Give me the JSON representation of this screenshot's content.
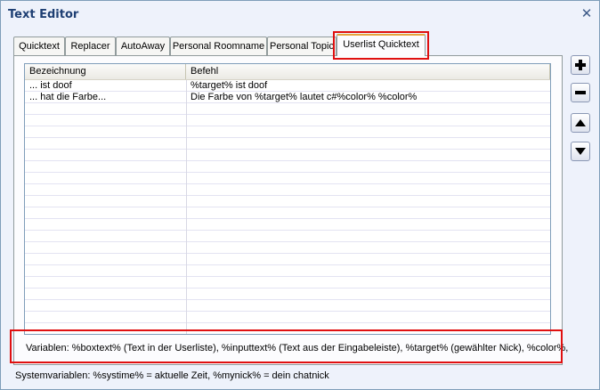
{
  "window": {
    "title": "Text Editor",
    "close_glyph": "✕"
  },
  "tabs": [
    {
      "label": "Quicktext",
      "active": false
    },
    {
      "label": "Replacer",
      "active": false
    },
    {
      "label": "AutoAway",
      "active": false
    },
    {
      "label": "Personal Roomname",
      "active": false
    },
    {
      "label": "Personal Topic",
      "active": false
    },
    {
      "label": "Userlist Quicktext",
      "active": true
    }
  ],
  "table": {
    "columns": [
      "Bezeichnung",
      "Befehl"
    ],
    "rows": [
      [
        "... ist doof",
        "%target% ist doof"
      ],
      [
        "... hat die Farbe...",
        "Die Farbe von %target% lautet c#%color% %color%"
      ]
    ]
  },
  "variables_text": "Variablen: %boxtext% (Text in der Userliste), %inputtext% (Text aus der Eingabeleiste), %target% (gewählter Nick), %color%,",
  "systemvariables_text": "Systemvariablen: %systime% = aktuelle Zeit, %mynick% = dein chatnick",
  "side_buttons": [
    {
      "name": "add-button",
      "icon": "plus-icon"
    },
    {
      "name": "remove-button",
      "icon": "minus-icon"
    },
    {
      "name": "move-up-button",
      "icon": "triangle-up-icon"
    },
    {
      "name": "move-down-button",
      "icon": "triangle-down-icon"
    }
  ],
  "colors": {
    "highlight": "#e01010",
    "active_tab_accent": "#e6a43c",
    "title": "#1e3f73"
  }
}
